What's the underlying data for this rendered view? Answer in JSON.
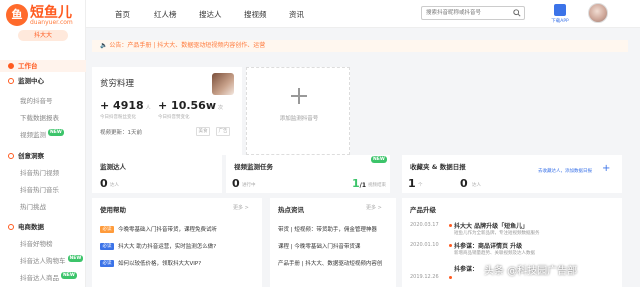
{
  "brand": {
    "logo_mark": "鱼",
    "name": "短鱼儿",
    "domain": "duanyuer.com",
    "product": "抖大大"
  },
  "colors": {
    "accent": "#ff5a1f",
    "link": "#3b73e8",
    "new_badge": "#3cc46a"
  },
  "top_nav": [
    "首页",
    "红人榜",
    "搜达人",
    "搜视频",
    "资讯"
  ],
  "search": {
    "placeholder": "搜索抖音昵称或抖音号"
  },
  "download_label": "下载APP",
  "sidebar": {
    "items": [
      {
        "label": "工作台",
        "group": true,
        "active": true
      },
      {
        "label": "监测中心",
        "group": true
      },
      {
        "label": "我的抖音号"
      },
      {
        "label": "下载数据报表"
      },
      {
        "label": "视频监测",
        "badge": "NEW"
      },
      {
        "label": "创意洞察",
        "group": true
      },
      {
        "label": "抖音热门视频"
      },
      {
        "label": "抖音热门音乐"
      },
      {
        "label": "热门挑战"
      },
      {
        "label": "电商数据",
        "group": true
      },
      {
        "label": "抖音好物榜"
      },
      {
        "label": "抖音达人购物车",
        "badge": "NEW"
      },
      {
        "label": "抖音达人商品",
        "badge": "NEW"
      }
    ]
  },
  "notice": "公告：产品手册 | 抖大大、数据驱动短视频内容创作、运营",
  "profile": {
    "name": "贫穷料理",
    "fans_delta": "+ 4918",
    "fans_unit": "人",
    "fans_label": "今日抖音粉丝变化",
    "likes_delta": "+ 10.56w",
    "likes_unit": "次",
    "likes_label": "今日抖音赞变化",
    "update_text": "视频更新：1天前",
    "tag1": "美食",
    "tag2": "广告"
  },
  "add_account": {
    "label": "添加监测抖音号"
  },
  "monitor_influencers": {
    "title": "监测达人",
    "value": "0",
    "unit": "达人"
  },
  "video_tasks": {
    "title": "视频监测任务",
    "badge": "NEW",
    "running": "0",
    "running_unit": "进行中",
    "done": "1",
    "total": "/1",
    "done_unit": "视频结束"
  },
  "favorites": {
    "title": "收藏夹 & 数据日报",
    "fav_value": "1",
    "fav_unit": "个",
    "daily_value": "0",
    "daily_unit": "达人",
    "add_link": "去收藏达人，添加数据日报"
  },
  "help": {
    "title": "使用帮助",
    "more": "更多 >",
    "rows": [
      {
        "badge": "必读",
        "text": "今晚零基础入门抖音带货，课程免费试听"
      },
      {
        "badge": "必读",
        "text": "抖大大 助力抖音运营，实时监测怎么做?"
      },
      {
        "badge": "必读",
        "text": "如何以较低价格，领取抖大大VIP?"
      }
    ]
  },
  "hot_news": {
    "title": "热点资讯",
    "more": "更多 >",
    "rows": [
      "带货 | 短视频：带货助手，佣金管理神器",
      "课程 | 今晚零基础入门抖音带货课",
      "产品手册 | 抖大大、数据驱动短视频内容创"
    ]
  },
  "product_updates": {
    "title": "产品升级",
    "items": [
      {
        "date": "2020.03.17",
        "title": "抖大大 品牌升级「短鱼儿」",
        "desc": "短鱼儿作为全新品牌，专注短视频数据服务"
      },
      {
        "date": "2020.01.10",
        "title": "抖参谋：商品详情页 升级",
        "desc": "新增商品销量趋势、关联视频及达人数据"
      },
      {
        "date": "2019.12.26",
        "title": "抖参谋：",
        "desc": ""
      }
    ]
  },
  "watermark": "头条 @科技园广告部"
}
